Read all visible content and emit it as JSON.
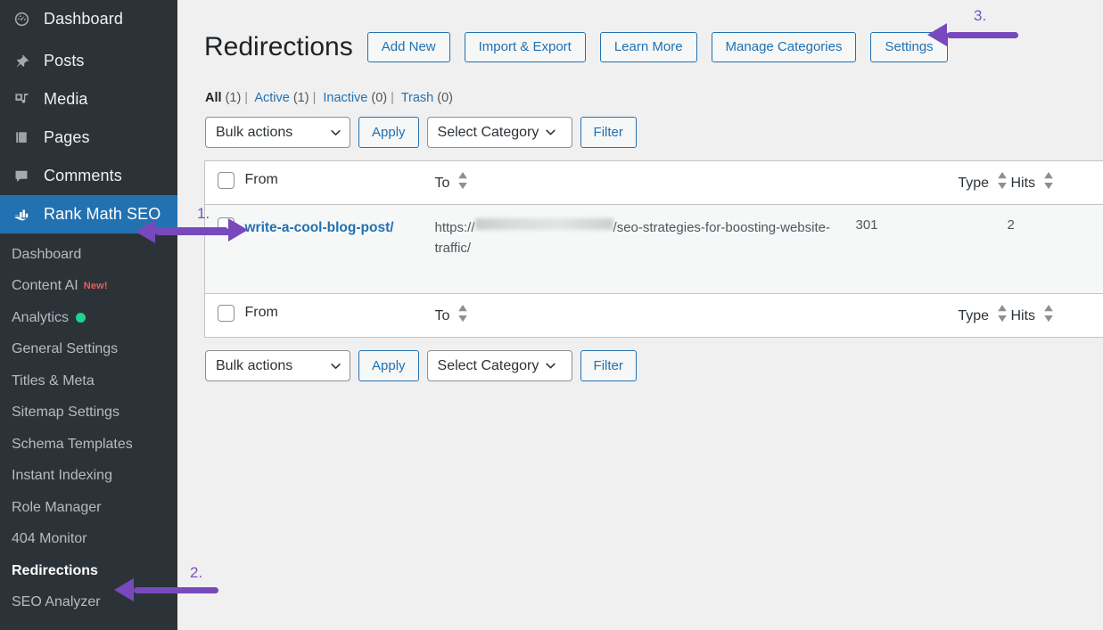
{
  "sidebar": {
    "top_items": [
      {
        "label": "Dashboard",
        "icon": "dashboard-gauge-icon",
        "active": false
      },
      {
        "label": "Posts",
        "icon": "pin-icon",
        "active": false
      },
      {
        "label": "Media",
        "icon": "media-icon",
        "active": false
      },
      {
        "label": "Pages",
        "icon": "pages-icon",
        "active": false
      },
      {
        "label": "Comments",
        "icon": "comment-bubble-icon",
        "active": false
      },
      {
        "label": "Rank Math SEO",
        "icon": "rank-math-logo-icon",
        "active": true
      }
    ],
    "sub_items": [
      {
        "label": "Dashboard",
        "badge": "",
        "dot": false,
        "current": false
      },
      {
        "label": "Content AI",
        "badge": "New!",
        "dot": false,
        "current": false
      },
      {
        "label": "Analytics",
        "badge": "",
        "dot": true,
        "current": false
      },
      {
        "label": "General Settings",
        "badge": "",
        "dot": false,
        "current": false
      },
      {
        "label": "Titles & Meta",
        "badge": "",
        "dot": false,
        "current": false
      },
      {
        "label": "Sitemap Settings",
        "badge": "",
        "dot": false,
        "current": false
      },
      {
        "label": "Schema Templates",
        "badge": "",
        "dot": false,
        "current": false
      },
      {
        "label": "Instant Indexing",
        "badge": "",
        "dot": false,
        "current": false
      },
      {
        "label": "Role Manager",
        "badge": "",
        "dot": false,
        "current": false
      },
      {
        "label": "404 Monitor",
        "badge": "",
        "dot": false,
        "current": false
      },
      {
        "label": "Redirections",
        "badge": "",
        "dot": false,
        "current": true
      },
      {
        "label": "SEO Analyzer",
        "badge": "",
        "dot": false,
        "current": false
      }
    ],
    "colors": {
      "background": "#2c3338",
      "active_background": "#2271b1",
      "badge_new": "#f05a5a",
      "dot": "#1ed38f"
    }
  },
  "header": {
    "title": "Redirections",
    "buttons": [
      {
        "label": "Add New"
      },
      {
        "label": "Import & Export"
      },
      {
        "label": "Learn More"
      },
      {
        "label": "Manage Categories"
      },
      {
        "label": "Settings"
      }
    ]
  },
  "status_filters": [
    {
      "label": "All",
      "count": "(1)",
      "current": true
    },
    {
      "label": "Active",
      "count": "(1)",
      "current": false
    },
    {
      "label": "Inactive",
      "count": "(0)",
      "current": false
    },
    {
      "label": "Trash",
      "count": "(0)",
      "current": false
    }
  ],
  "tablenav_top": {
    "bulk_actions_value": "Bulk actions",
    "apply_label": "Apply",
    "category_value": "Select Category",
    "filter_label": "Filter"
  },
  "tablenav_bottom": {
    "bulk_actions_value": "Bulk actions",
    "apply_label": "Apply",
    "category_value": "Select Category",
    "filter_label": "Filter"
  },
  "table": {
    "columns": [
      {
        "key": "cb",
        "label": "",
        "sortable": false
      },
      {
        "key": "from",
        "label": "From",
        "sortable": false
      },
      {
        "key": "to",
        "label": "To",
        "sortable": true
      },
      {
        "key": "type",
        "label": "Type",
        "sortable": true
      },
      {
        "key": "hits",
        "label": "Hits",
        "sortable": true
      }
    ],
    "rows": [
      {
        "from": "write-a-cool-blog-post/",
        "to_prefix": "https://",
        "to_redacted": " ",
        "to_suffix": "/seo-strategies-for-boosting-website-traffic/",
        "type": "301",
        "hits": "2"
      }
    ]
  },
  "annotations": [
    {
      "id": "1",
      "label": "1.",
      "direction": "right"
    },
    {
      "id": "2",
      "label": "2.",
      "direction": "left"
    },
    {
      "id": "3",
      "label": "3.",
      "direction": "left"
    }
  ],
  "accent_color": "#7749bd"
}
